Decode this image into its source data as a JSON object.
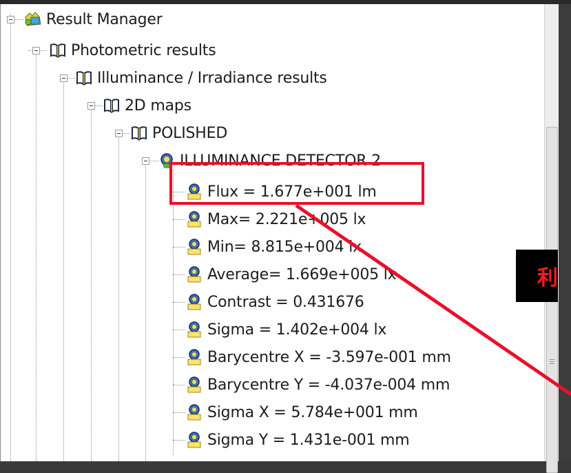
{
  "tree": {
    "root": {
      "label": "Result Manager",
      "icon": "result-manager-icon"
    },
    "photometric": {
      "label": "Photometric results",
      "icon": "book-icon"
    },
    "illuminance": {
      "label": "Illuminance / Irradiance results",
      "icon": "book-icon"
    },
    "maps2d": {
      "label": "2D maps",
      "icon": "book-icon"
    },
    "polished": {
      "label": "POLISHED",
      "icon": "book-icon"
    },
    "detector": {
      "label": "ILLUMINANCE DETECTOR 2",
      "icon": "detector-icon"
    },
    "results": [
      {
        "label": "Flux = 1.677e+001 lm"
      },
      {
        "label": "Max= 2.221e+005 lx"
      },
      {
        "label": "Min= 8.815e+004 lx"
      },
      {
        "label": "Average= 1.669e+005 lx"
      },
      {
        "label": "Contrast = 0.431676"
      },
      {
        "label": "Sigma = 1.402e+004 lx"
      },
      {
        "label": "Barycentre X = -3.597e-001 mm"
      },
      {
        "label": "Barycentre Y = -4.037e-004 mm"
      },
      {
        "label": "Sigma X = 5.784e+001 mm"
      },
      {
        "label": "Sigma Y = 1.431e-001 mm"
      }
    ]
  },
  "callout": {
    "text": "利"
  },
  "colors": {
    "highlight": "#e8102a",
    "callout_text": "#ff1a1a",
    "callout_bg": "#000000"
  }
}
